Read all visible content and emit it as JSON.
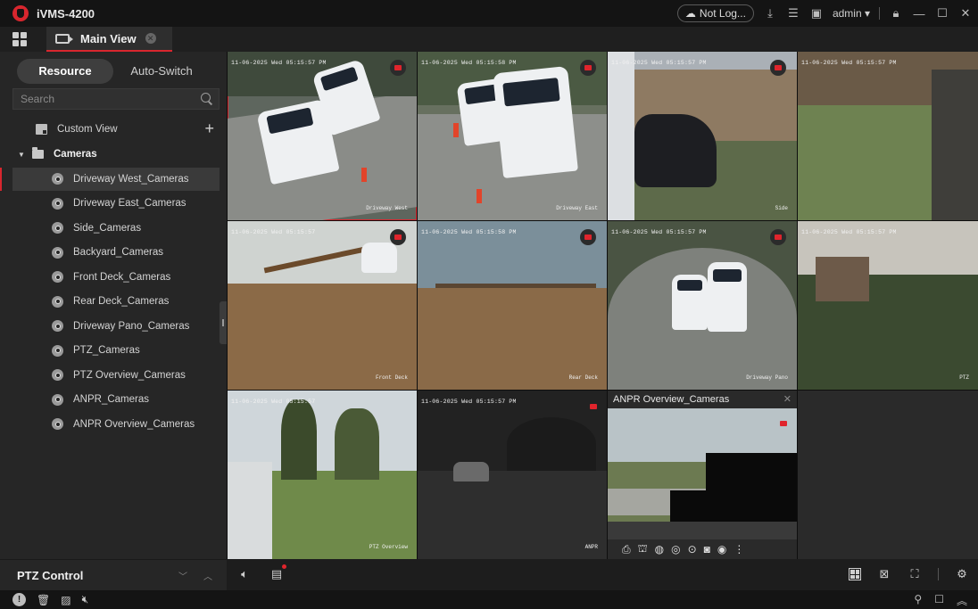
{
  "app": {
    "title": "iVMS-4200"
  },
  "titlebar": {
    "status": "Not Log...",
    "user": "admin"
  },
  "tabs": [
    {
      "label": "Main View"
    }
  ],
  "sidebar": {
    "seg": [
      "Resource",
      "Auto-Switch"
    ],
    "search_placeholder": "Search",
    "custom_view": "Custom View",
    "cameras_group": "Cameras",
    "cameras": [
      "Driveway West_Cameras",
      "Driveway East_Cameras",
      "Side_Cameras",
      "Backyard_Cameras",
      "Front Deck_Cameras",
      "Rear Deck_Cameras",
      "Driveway Pano_Cameras",
      "PTZ_Cameras",
      "PTZ Overview_Cameras",
      "ANPR_Cameras",
      "ANPR Overview_Cameras"
    ],
    "ptz_title": "PTZ Control"
  },
  "tiles": [
    {
      "ts": "11-06-2025 Wed 05:15:57 PM",
      "osd": "Driveway West"
    },
    {
      "ts": "11-06-2025 Wed 05:15:58 PM",
      "osd": "Driveway East"
    },
    {
      "ts": "11-06-2025 Wed 05:15:57 PM",
      "osd": "Side"
    },
    {
      "ts": "11-06-2025 Wed 05:15:57 PM",
      "osd": ""
    },
    {
      "ts": "11-06-2025 Wed 05:15:57",
      "osd": "Front Deck"
    },
    {
      "ts": "11-06-2025 Wed 05:15:58 PM",
      "osd": "Rear Deck"
    },
    {
      "ts": "11-06-2025 Wed 05:15:57 PM",
      "osd": "Driveway Pano"
    },
    {
      "ts": "11-06-2025 Wed 05:15:57 PM",
      "osd": "PTZ"
    },
    {
      "ts": "11-06-2025 Wed 05:15:57",
      "osd": "PTZ Overview"
    },
    {
      "ts": "11-06-2025 Wed 05:15:57 PM",
      "osd": "ANPR"
    },
    {
      "ts": "",
      "osd": "",
      "header": "ANPR Overview_Cameras"
    }
  ],
  "colors": {
    "accent": "#d8262e",
    "background": "#1b1b1b",
    "panel": "#262626"
  }
}
